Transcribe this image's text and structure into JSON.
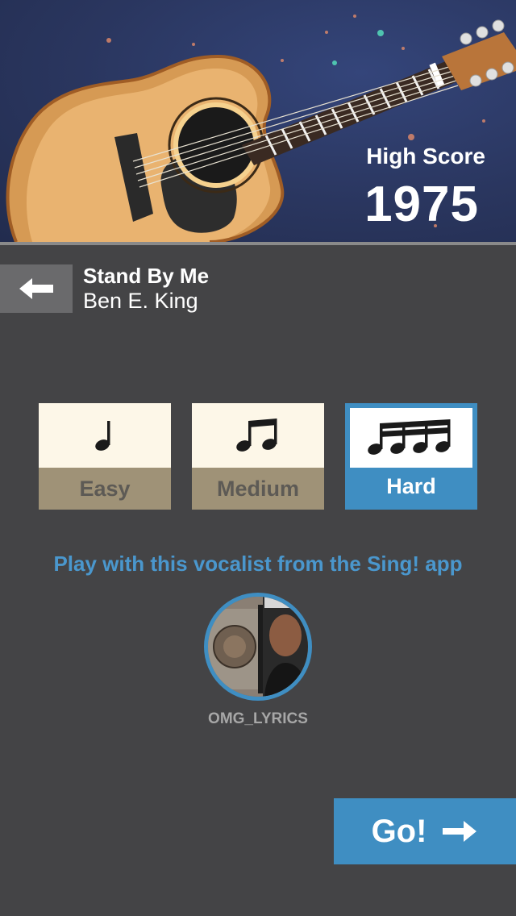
{
  "header": {
    "high_score_label": "High Score",
    "high_score_value": "1975",
    "colors": {
      "background": "#2a365f"
    }
  },
  "song": {
    "title": "Stand By Me",
    "artist": "Ben E. King",
    "back_icon": "arrow-left-icon"
  },
  "difficulty": {
    "options": [
      {
        "label": "Easy",
        "icon": "quarter-note-icon",
        "selected": false
      },
      {
        "label": "Medium",
        "icon": "eighth-notes-icon",
        "selected": false
      },
      {
        "label": "Hard",
        "icon": "sixteenth-notes-icon",
        "selected": true
      }
    ]
  },
  "vocalist": {
    "prompt": "Play with this vocalist from the Sing! app",
    "username": "OMG_LYRICS"
  },
  "go_button": {
    "label": "Go!",
    "icon": "arrow-right-icon"
  },
  "colors": {
    "accent": "#3f8ec2",
    "background": "#444446",
    "tile_top": "#fdf7e8",
    "tile_bottom": "#9f9277"
  }
}
